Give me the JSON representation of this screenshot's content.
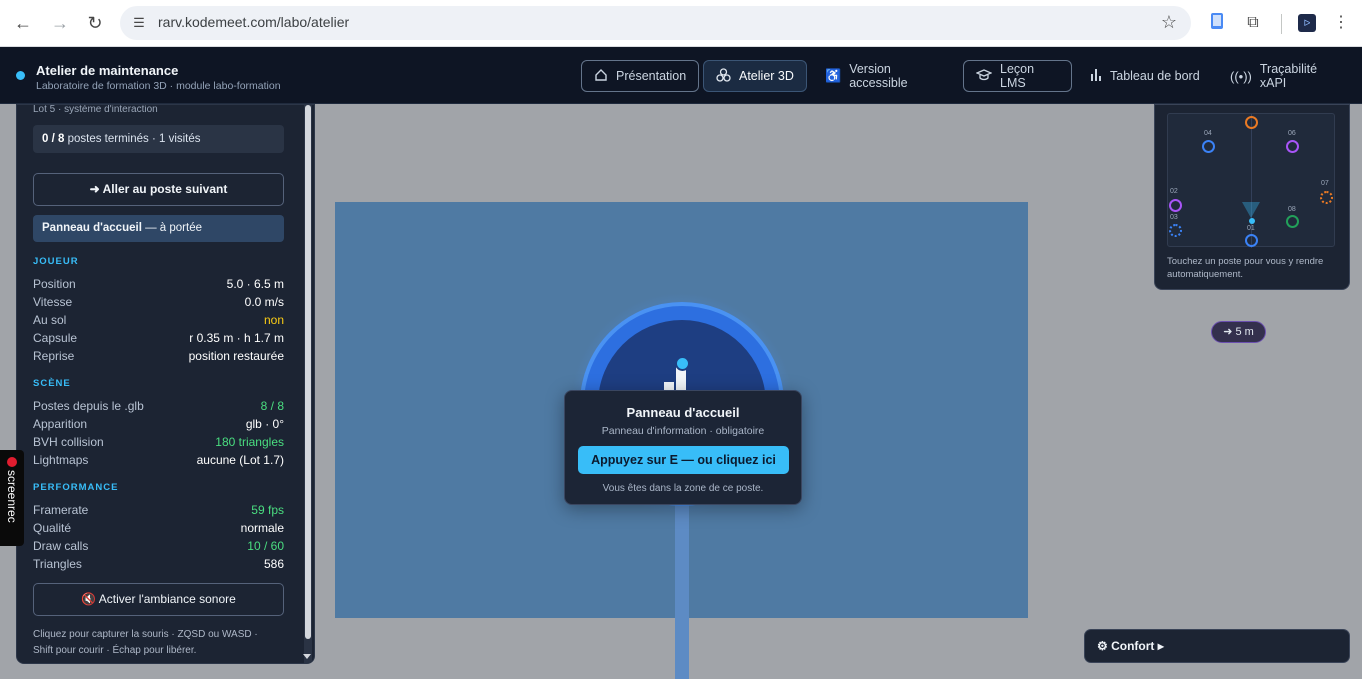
{
  "browser": {
    "url": "rarv.kodemeet.com/labo/atelier",
    "profile_badge": "ᐅ"
  },
  "header": {
    "title": "Atelier de maintenance",
    "subtitle": "Laboratoire de formation 3D · module labo-formation",
    "nav": [
      {
        "label": "Présentation",
        "icon": "home-icon"
      },
      {
        "label": "Atelier 3D",
        "icon": "cubes-icon"
      },
      {
        "label": "Version accessible",
        "icon": "accessibility-icon"
      },
      {
        "label": "Leçon LMS",
        "icon": "graduation-cap-icon"
      },
      {
        "label": "Tableau de bord",
        "icon": "bar-chart-icon"
      },
      {
        "label": "Traçabilité xAPI",
        "icon": "broadcast-icon"
      }
    ]
  },
  "panel": {
    "lot_label": "Lot 5 · système d'interaction",
    "progress_strong": "0 / 8",
    "progress_rest": " postes terminés · 1 visités",
    "next_button": "➜ Aller au poste suivant",
    "station_name": "Panneau d'accueil",
    "station_status": " — à portée",
    "player": {
      "title": "JOUEUR",
      "rows": [
        {
          "k": "Position",
          "v": "5.0 · 6.5 m"
        },
        {
          "k": "Vitesse",
          "v": "0.0 m/s"
        },
        {
          "k": "Au sol",
          "v": "non"
        },
        {
          "k": "Capsule",
          "v": "r 0.35 m · h 1.7 m"
        },
        {
          "k": "Reprise",
          "v": "position restaurée"
        }
      ]
    },
    "scene": {
      "title": "SCÈNE",
      "rows": [
        {
          "k": "Postes depuis le .glb",
          "v": "8 / 8"
        },
        {
          "k": "Apparition",
          "v": "glb · 0°"
        },
        {
          "k": "BVH collision",
          "v": "180 triangles"
        },
        {
          "k": "Lightmaps",
          "v": "aucune (Lot 1.7)"
        }
      ]
    },
    "performance": {
      "title": "PERFORMANCE",
      "rows": [
        {
          "k": "Framerate",
          "v": "59 fps"
        },
        {
          "k": "Qualité",
          "v": "normale"
        },
        {
          "k": "Draw calls",
          "v": "10 / 60"
        },
        {
          "k": "Triangles",
          "v": "586"
        }
      ]
    },
    "sound_button": "🔇 Activer l'ambiance sonore",
    "help_line1": "Cliquez pour capturer la souris · ZQSD ou WASD ·",
    "help_line2": "Shift pour courir · Échap pour libérer."
  },
  "prompt": {
    "title": "Panneau d'accueil",
    "subtitle": "Panneau d'information · obligatoire",
    "button": "Appuyez sur E — ou cliquez ici",
    "hint": "Vous êtes dans la zone de ce poste."
  },
  "minimap": {
    "labels": [
      "04",
      "06",
      "02",
      "03",
      "07",
      "08",
      "01"
    ],
    "help": "Touchez un poste pour vous y rendre automatiquement."
  },
  "distance_badge": "➜ 5 m",
  "comfort_button": "⚙ Confort ▸",
  "screenrec": "screenrec",
  "colors": {
    "accent": "#38bdf8",
    "warning": "#facc15",
    "ok": "#4ade80",
    "floor": "#4f7aa3"
  }
}
